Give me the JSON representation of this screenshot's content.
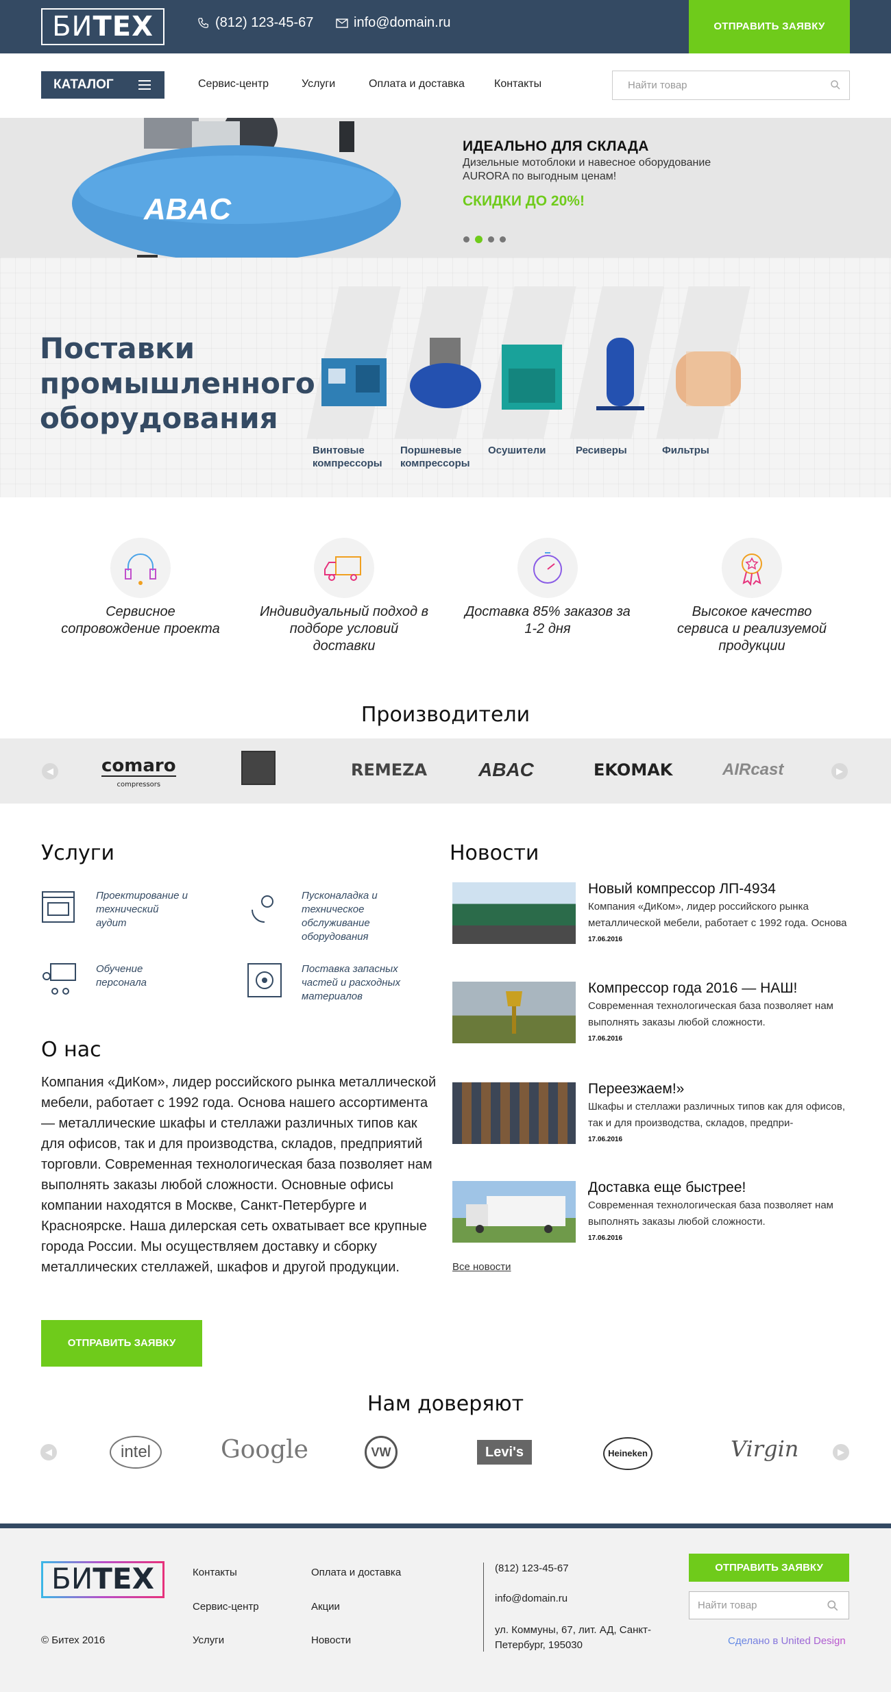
{
  "header": {
    "logo_a": "БИ",
    "logo_b": "ТЕХ",
    "phone": "(812) 123-45-67",
    "email": "info@domain.ru",
    "request_btn": "ОТПРАВИТЬ ЗАЯВКУ"
  },
  "nav": {
    "catalog": "КАТАЛОГ",
    "links": [
      "Сервис-центр",
      "Услуги",
      "Оплата и доставка",
      "Контакты"
    ],
    "search_placeholder": "Найти товар"
  },
  "banner": {
    "title": "ИДЕАЛЬНО ДЛЯ СКЛАДА",
    "text": "Дизельные мотоблоки и навесное оборудование AURORA по выгодным ценам!",
    "sale": "СКИДКИ ДО 20%!",
    "compressor_brand": "ABAC",
    "slides": 4,
    "active_slide": 2
  },
  "supply": {
    "title": "Поставки промышленного оборудования",
    "categories": [
      {
        "label": "Винтовые компрессоры"
      },
      {
        "label": "Поршневые компрессоры"
      },
      {
        "label": "Осушители"
      },
      {
        "label": "Ресиверы"
      },
      {
        "label": "Фильтры"
      }
    ]
  },
  "features": [
    "Сервисное сопровождение проекта",
    "Индивидуальный подход в подборе условий доставки",
    "Доставка 85% заказов за 1-2 дня",
    "Высокое качество сервиса и реализуемой продукции"
  ],
  "producers": {
    "title": "Производители",
    "logos": [
      "comaro",
      "compressors",
      "REMEZA",
      "ABAC",
      "EKOMAK",
      "AIRcast"
    ]
  },
  "services": {
    "title": "Услуги",
    "items": [
      "Проектирование и технический аудит",
      "Пусконаладка и техническое обслуживание оборудования",
      "Обучение персонала",
      "Поставка запасных частей и расходных материалов"
    ]
  },
  "about": {
    "title": "О нас",
    "text": "Компания «ДиКом», лидер российского рынка металлической мебели, работает с 1992 года. Основа нашего ассортимента — металлические шкафы и стеллажи различных типов как для офисов, так и для производства, складов, предприятий торговли. Современная технологическая база позволяет нам выполнять заказы любой сложности. Основные офисы компании находятся в Москве, Санкт-Петербурге и Красноярске. Наша дилерская сеть охватывает все крупные города России. Мы осуществляем доставку и сборку металлических стеллажей, шкафов и другой продукции.",
    "btn": "ОТПРАВИТЬ ЗАЯВКУ"
  },
  "news": {
    "title": "Новости",
    "items": [
      {
        "title": "Новый компрессор ЛП-4934",
        "text": "Компания «ДиКом», лидер российского рынка металлической мебели, работает с 1992 года. Основа",
        "date": "17.06.2016"
      },
      {
        "title": "Компрессор года 2016 — НАШ!",
        "text": "Современная технологическая база позволяет нам выполнять заказы любой сложности.",
        "date": "17.06.2016"
      },
      {
        "title": "Переезжаем!»",
        "text": "Шкафы и стеллажи различных типов как для офисов, так и для производства, складов, предпри-",
        "date": "17.06.2016"
      },
      {
        "title": "Доставка еще быстрее!",
        "text": "Современная технологическая база позволяет нам выполнять заказы любой сложности.",
        "date": "17.06.2016"
      }
    ],
    "all": "Все новости"
  },
  "trust": {
    "title": "Нам доверяют",
    "logos": [
      "intel",
      "Google",
      "VW",
      "Levi's",
      "Heineken",
      "Virgin"
    ]
  },
  "footer": {
    "logo_a": "БИ",
    "logo_b": "ТЕХ",
    "copyright": "© Битех 2016",
    "links_col1": [
      "Контакты",
      "Сервис-центр",
      "Услуги"
    ],
    "links_col2": [
      "Оплата и доставка",
      "Акции",
      "Новости"
    ],
    "phone": "(812) 123-45-67",
    "email": "info@domain.ru",
    "address": "ул. Коммуны, 67, лит. АД, Санкт-Петербург, 195030",
    "btn": "ОТПРАВИТЬ ЗАЯВКУ",
    "search_placeholder": "Найти товар",
    "made_by": "Сделано в United Design"
  },
  "colors": {
    "brand": "#344a63",
    "accent": "#6fcb1b"
  }
}
